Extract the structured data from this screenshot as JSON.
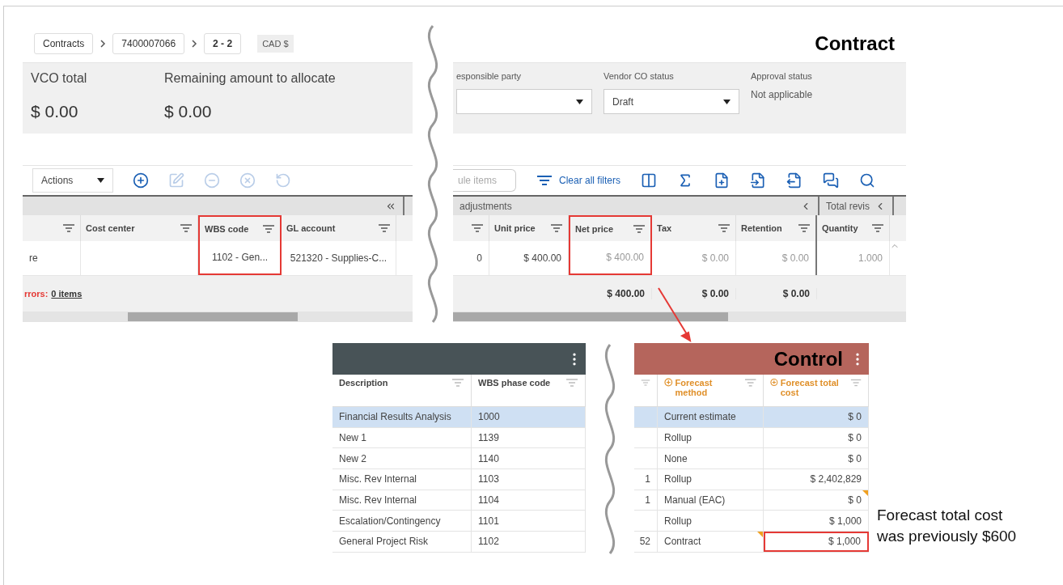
{
  "contract": {
    "title": "Contract",
    "breadcrumbs": [
      {
        "label": "Contracts",
        "selected": false
      },
      {
        "label": "7400007066",
        "selected": false
      },
      {
        "label": "2 - 2",
        "selected": true
      }
    ],
    "currency": "CAD $",
    "summary": [
      {
        "label": "VCO total",
        "value": "$ 0.00"
      },
      {
        "label": "Remaining amount to allocate",
        "value": "$ 0.00"
      }
    ],
    "fields": [
      {
        "label": "esponsible party",
        "kind": "select"
      },
      {
        "label": "Vendor CO status",
        "kind": "select",
        "value": "Draft"
      },
      {
        "label": "Approval status",
        "kind": "text",
        "value": "Not applicable"
      }
    ],
    "actions_label": "Actions",
    "row_tools": [
      {
        "kind": "add",
        "disabled": false
      },
      {
        "kind": "edit",
        "disabled": true
      },
      {
        "kind": "remove",
        "disabled": true
      },
      {
        "kind": "cancel",
        "disabled": true
      },
      {
        "kind": "undo",
        "disabled": true
      }
    ],
    "items_search": "ule items",
    "clear_filters": "Clear all filters",
    "grid_tools": [
      {
        "kind": "columns"
      },
      {
        "kind": "sum"
      },
      {
        "kind": "add-doc"
      },
      {
        "kind": "import"
      },
      {
        "kind": "export"
      },
      {
        "kind": "comments"
      },
      {
        "kind": "search"
      }
    ],
    "left_grid": {
      "columns": [
        {
          "label": "Cost center",
          "highlighted": false
        },
        {
          "label": "WBS code",
          "highlighted": true
        },
        {
          "label": "GL account",
          "highlighted": false
        }
      ],
      "row": {
        "column_1": "re",
        "wbs_code": "1102 - Gen...",
        "gl_account": "521320 - Supplies-C..."
      },
      "errors_label": "rrors:",
      "errors_link": "0 items"
    },
    "right_grid": {
      "group": "adjustments",
      "group_2": "Total revis",
      "columns": [
        {
          "label": "Unit price",
          "highlighted": false
        },
        {
          "label": "Net price",
          "highlighted": true
        },
        {
          "label": "Tax",
          "highlighted": false
        },
        {
          "label": "Retention",
          "highlighted": false
        },
        {
          "label": "Quantity",
          "highlighted": false
        }
      ],
      "row": [
        "0",
        "$ 400.00",
        "$ 400.00",
        "$ 0.00",
        "$ 0.00",
        "1.000"
      ],
      "totals": [
        "$ 400.00",
        "$ 0.00",
        "$ 0.00"
      ]
    }
  },
  "control": {
    "title": "Control",
    "columns": [
      "Description",
      "WBS phase code",
      "Forecast method",
      "Forecast total cost"
    ],
    "rows": [
      {
        "description": "Financial Results Analysis",
        "code": "1000",
        "method": "Current estimate",
        "cost": "$ 0",
        "selected": true,
        "flag_method": false,
        "flag_cost": false,
        "highlighted": false
      },
      {
        "description": "New 1",
        "code": "1139",
        "method": "Rollup",
        "cost": "$ 0",
        "selected": false,
        "flag_method": false,
        "flag_cost": false,
        "highlighted": false
      },
      {
        "description": "New 2",
        "code": "1140",
        "method": "None",
        "cost": "$ 0",
        "selected": false,
        "flag_method": false,
        "flag_cost": false,
        "highlighted": false
      },
      {
        "description": "Misc. Rev Internal",
        "code": "1103",
        "column_3": "1",
        "method": "Rollup",
        "cost": "$ 2,402,829",
        "selected": false,
        "flag_method": false,
        "flag_cost": false,
        "highlighted": false
      },
      {
        "description": "Misc. Rev Internal",
        "code": "1104",
        "column_3": "1",
        "method": "Manual (EAC)",
        "cost": "$ 0",
        "selected": false,
        "flag_method": false,
        "flag_cost": true,
        "highlighted": false
      },
      {
        "description": "Escalation/Contingency",
        "code": "1101",
        "method": "Rollup",
        "cost": "$ 1,000",
        "selected": false,
        "flag_method": false,
        "flag_cost": false,
        "highlighted": false
      },
      {
        "description": "General Project Risk",
        "code": "1102",
        "column_3": "52",
        "method": "Contract",
        "cost": "$ 1,000",
        "selected": false,
        "flag_method": true,
        "flag_cost": false,
        "highlighted": true
      }
    ]
  },
  "note": "Forecast total cost was previously $600"
}
